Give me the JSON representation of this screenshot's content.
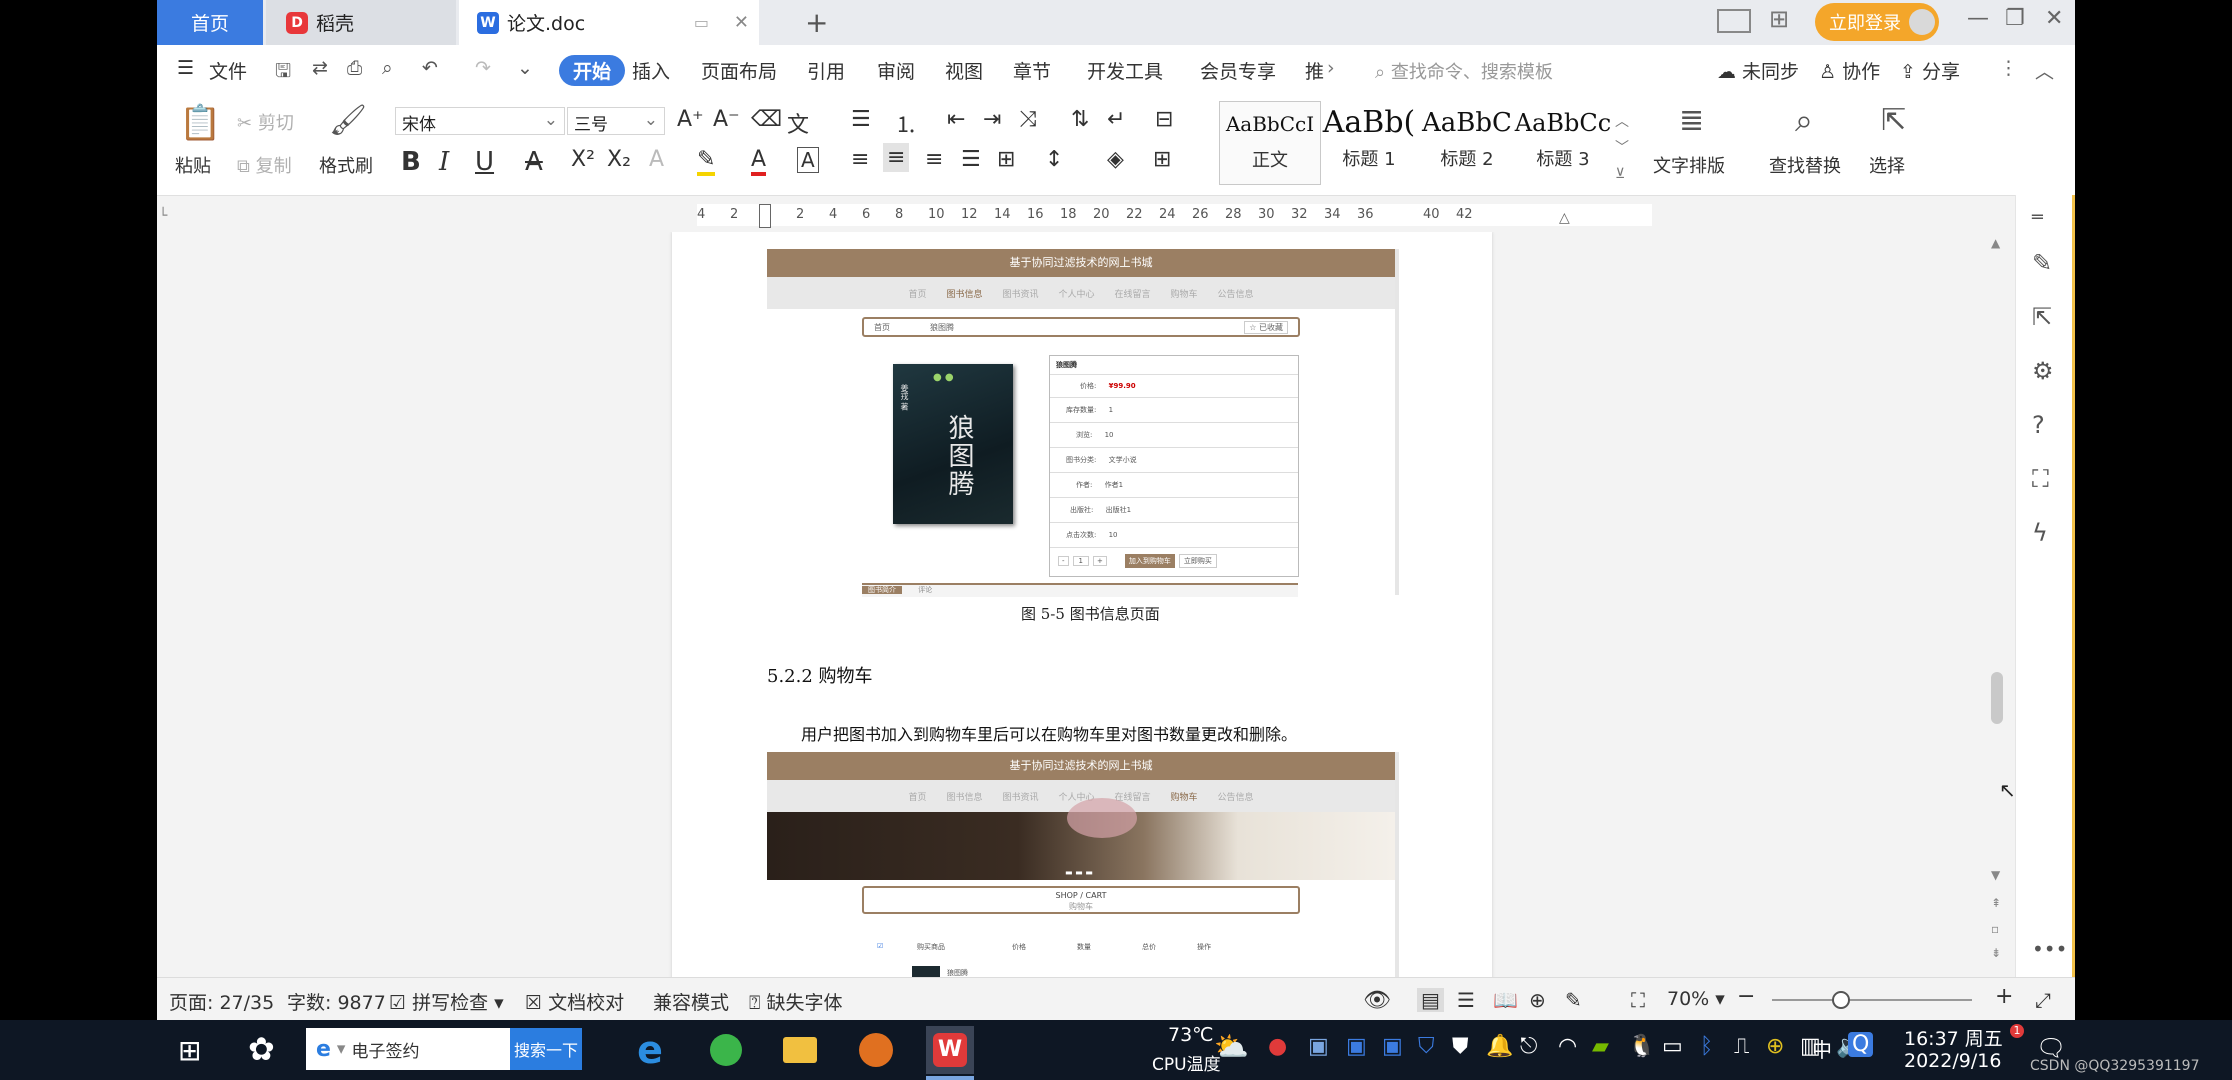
{
  "tabs": {
    "home": "首页",
    "daoke": "稻壳",
    "doc": "论文.doc"
  },
  "topbar": {
    "login": "立即登录"
  },
  "menu": {
    "file": "文件",
    "start": "开始",
    "insert": "插入",
    "layout": "页面布局",
    "reference": "引用",
    "review": "审阅",
    "view": "视图",
    "chapter": "章节",
    "devtools": "开发工具",
    "member": "会员专享",
    "more": "推",
    "search_placeholder": "查找命令、搜索模板",
    "unsync": "未同步",
    "collab": "协作",
    "share": "分享"
  },
  "ribbon": {
    "paste": "粘贴",
    "cut": "剪切",
    "copy": "复制",
    "format_painter": "格式刷",
    "font": "宋体",
    "size": "三号",
    "styles": [
      {
        "preview": "AaBbCcI",
        "name": "正文"
      },
      {
        "preview": "AaBb(",
        "name": "标题 1"
      },
      {
        "preview": "AaBbC",
        "name": "标题 2"
      },
      {
        "preview": "AaBbCc",
        "name": "标题 3"
      }
    ],
    "text_layout": "文字排版",
    "find_replace": "查找替换",
    "select": "选择"
  },
  "ruler": {
    "ticks": [
      "4",
      "2",
      "",
      "2",
      "4",
      "6",
      "8",
      "10",
      "12",
      "14",
      "16",
      "18",
      "20",
      "22",
      "24",
      "26",
      "28",
      "30",
      "32",
      "34",
      "36",
      "",
      "40",
      "42"
    ]
  },
  "document": {
    "shot1": {
      "header": "基于协同过滤技术的网上书城",
      "nav": [
        "首页",
        "图书信息",
        "图书资讯",
        "个人中心",
        "在线留言",
        "购物车",
        "公告信息"
      ],
      "breadcrumb_home": "首页",
      "breadcrumb_item": "狼图腾",
      "collect": "☆ 已收藏",
      "book_title": "狼图腾",
      "book_cover_title": "狼图腾",
      "book_cover_author": "姜戎 著",
      "price_label": "价格:",
      "price": "¥99.90",
      "fields": [
        {
          "k": "库存数量:",
          "v": "1"
        },
        {
          "k": "浏览:",
          "v": "10"
        },
        {
          "k": "图书分类:",
          "v": "文学小说"
        },
        {
          "k": "作者:",
          "v": "作者1"
        },
        {
          "k": "出版社:",
          "v": "出版社1"
        },
        {
          "k": "点击次数:",
          "v": "10"
        }
      ],
      "qty": "1",
      "add_cart": "加入到购物车",
      "buy": "立即购买",
      "tab1": "图书简介",
      "tab2": "评论"
    },
    "caption1": "图 5-5 图书信息页面",
    "heading": "5.2.2 购物车",
    "para": "用户把图书加入到购物车里后可以在购物车里对图书数量更改和删除。",
    "shot2": {
      "header": "基于协同过滤技术的网上书城",
      "nav": [
        "首页",
        "图书信息",
        "图书资讯",
        "个人中心",
        "在线留言",
        "购物车",
        "公告信息"
      ],
      "cart_title_en": "SHOP / CART",
      "cart_title_cn": "购物车",
      "cols": [
        "购买商品",
        "价格",
        "数量",
        "总价",
        "操作"
      ],
      "item": "狼图腾"
    }
  },
  "status": {
    "page": "页面: 27/35",
    "words": "字数: 9877",
    "spell": "拼写检查",
    "proof": "文档校对",
    "compat": "兼容模式",
    "missing_font": "缺失字体",
    "zoom": "70%"
  },
  "taskbar": {
    "search_text": "电子签约",
    "search_btn": "搜索一下",
    "temp": "73℃",
    "temp_label": "CPU温度",
    "ime": "中",
    "time": "16:37 周五",
    "date": "2022/9/16",
    "watermark": "CSDN @QQ3295391197",
    "badge": "1"
  }
}
